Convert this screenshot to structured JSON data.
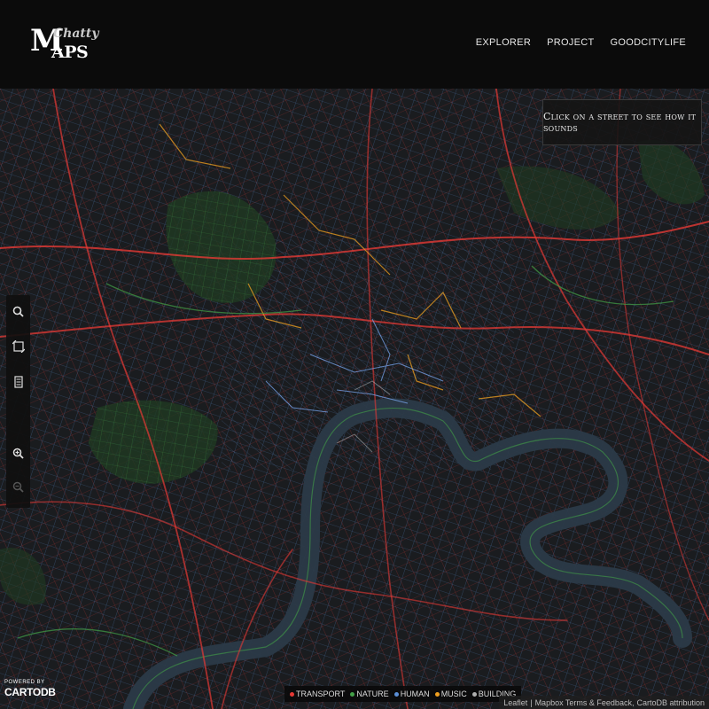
{
  "logo": {
    "m": "M",
    "chatty": "Chatty",
    "aps": "APS"
  },
  "nav": [
    {
      "label": "EXPLORER"
    },
    {
      "label": "PROJECT"
    },
    {
      "label": "GOODCITYLIFE"
    }
  ],
  "hint": "Click on a street to see how it sounds",
  "toolbar": {
    "tools": [
      {
        "icon": "search-icon"
      },
      {
        "icon": "share-icon"
      },
      {
        "icon": "layers-icon"
      },
      {
        "icon": "zoom-in-icon"
      },
      {
        "icon": "zoom-out-icon"
      }
    ]
  },
  "legend": [
    {
      "label": "TRANSPORT",
      "color": "#e53935"
    },
    {
      "label": "NATURE",
      "color": "#43a047"
    },
    {
      "label": "HUMAN",
      "color": "#5b8fd6"
    },
    {
      "label": "MUSIC",
      "color": "#f0a020"
    },
    {
      "label": "BUILDING",
      "color": "#b0b0b0"
    }
  ],
  "powered": {
    "small": "POWERED BY",
    "brand": "CARTODB"
  },
  "attribution": {
    "leaflet": "Leaflet",
    "sep": "|",
    "mapbox": "Mapbox Terms & Feedback,",
    "cartodb": "CartoDB attribution"
  },
  "colors": {
    "transport": "#e53935",
    "nature": "#43a047",
    "human": "#5b8fd6",
    "music": "#f0a020",
    "building": "#b0b0b0",
    "river": "#2b3a48",
    "land": "#1a1c1f"
  }
}
